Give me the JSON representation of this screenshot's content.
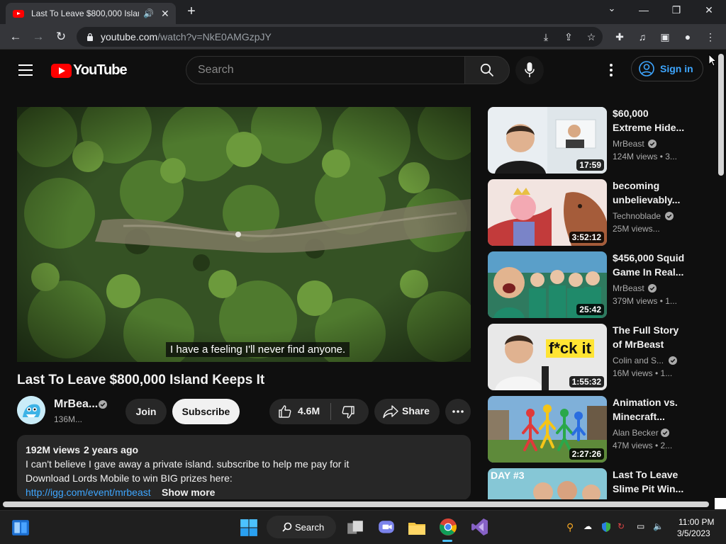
{
  "browser": {
    "tab_title": "Last To Leave $800,000 Island Keeps It",
    "url_host": "youtube.com",
    "url_path": "/watch?v=NkE0AMGzpJY",
    "new_tab": "+",
    "win_minimize": "—",
    "win_restore": "❐",
    "win_close": "✕",
    "tab_close": "✕"
  },
  "youtube": {
    "logo_text": "YouTube",
    "search_placeholder": "Search",
    "sign_in": "Sign in"
  },
  "video": {
    "caption": "I have a feeling I'll never find anyone.",
    "title": "Last To Leave $800,000 Island Keeps It",
    "channel": "MrBea...",
    "subscribers": "136M...",
    "join": "Join",
    "subscribe": "Subscribe",
    "likes": "4.6M",
    "share": "Share",
    "description": {
      "views": "192M views",
      "age": "2 years ago",
      "line1": "I can't believe I gave away a private island. subscribe to help me pay for it",
      "line2": "Download Lords Mobile to win BIG prizes here:",
      "link": "http://igg.com/event/mrbeast",
      "show_more": "Show more"
    }
  },
  "recommendations": [
    {
      "title1": "$60,000",
      "title2": "Extreme Hide...",
      "channel": "MrBeast",
      "verified": true,
      "meta": "124M views  • 3...",
      "duration": "17:59"
    },
    {
      "title1": "becoming",
      "title2": "unbelievably...",
      "channel": "Technoblade",
      "verified": true,
      "meta": "25M views...",
      "duration": "3:52:12"
    },
    {
      "title1": "$456,000 Squid",
      "title2": "Game In Real...",
      "channel": "MrBeast",
      "verified": true,
      "meta": "379M views  • 1...",
      "duration": "25:42"
    },
    {
      "title1": "The Full Story",
      "title2": "of MrBeast",
      "channel": "Colin and S...",
      "verified": true,
      "meta": "16M views  • 1...",
      "duration": "1:55:32"
    },
    {
      "title1": "Animation vs.",
      "title2": "Minecraft...",
      "channel": "Alan Becker",
      "verified": true,
      "meta": "47M views  • 2...",
      "duration": "2:27:26"
    },
    {
      "title1": "Last To Leave",
      "title2": "Slime Pit Win...",
      "channel": "",
      "verified": false,
      "meta": "",
      "duration": ""
    }
  ],
  "thumb_text": {
    "fck": "f*ck it",
    "day3": "DAY #3"
  },
  "taskbar": {
    "search": "Search",
    "time": "11:00 PM",
    "date": "3/5/2023"
  }
}
